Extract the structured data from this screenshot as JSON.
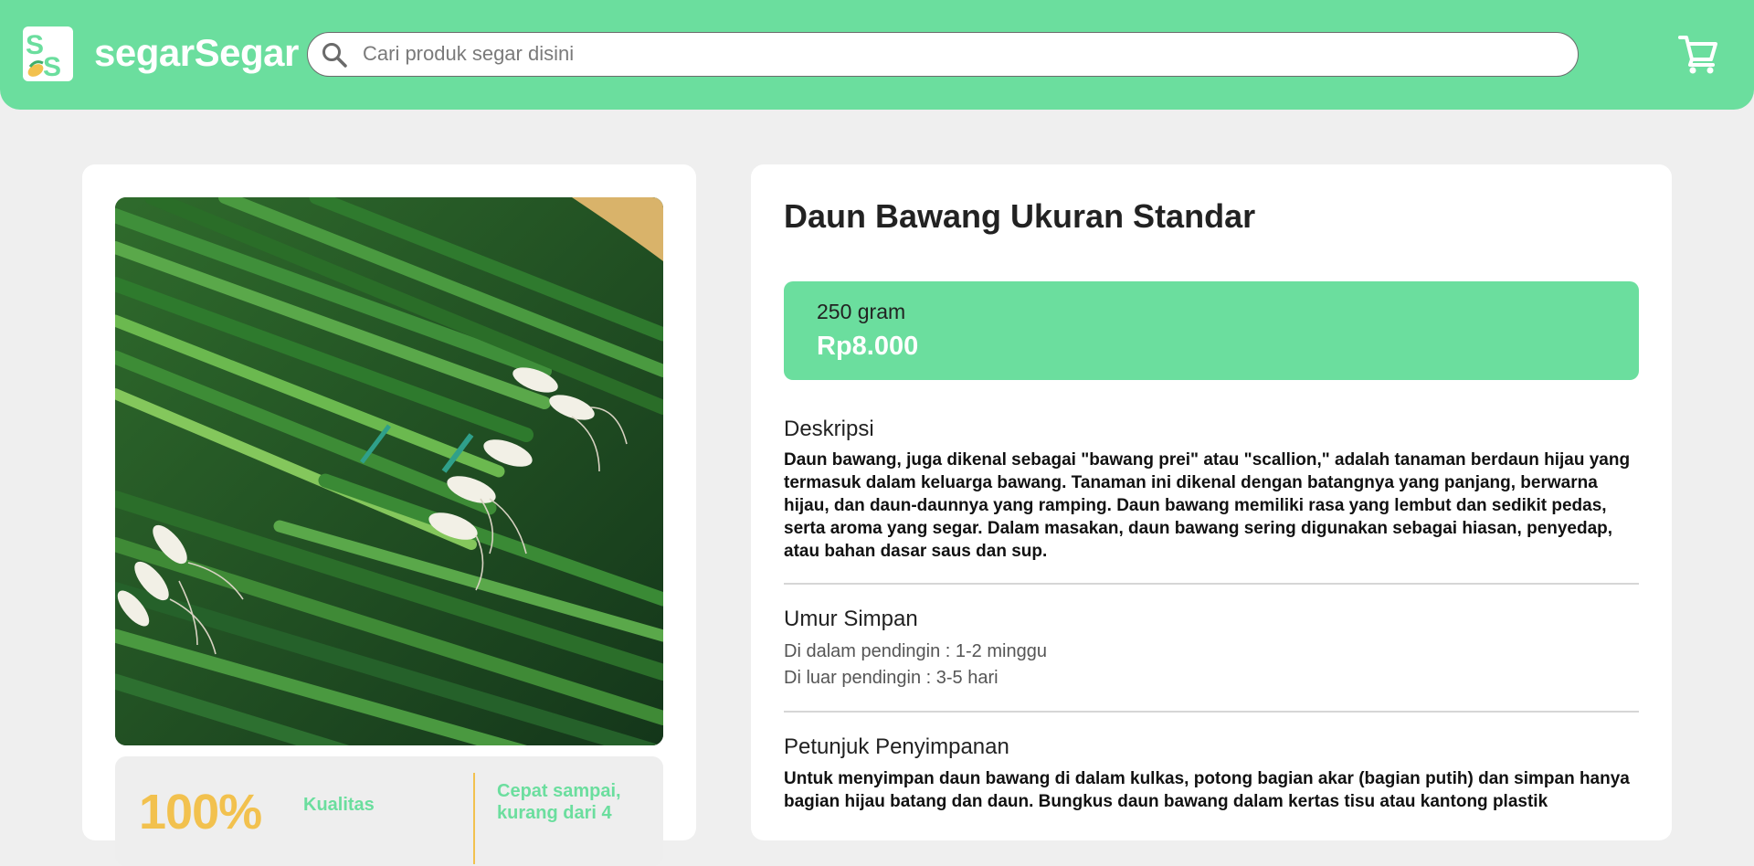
{
  "header": {
    "brand": "segarSegar",
    "search": {
      "placeholder": "Cari produk segar disini",
      "value": ""
    }
  },
  "icons": {
    "logo": "segarsegar-logo-icon",
    "search": "search-icon",
    "cart": "cart-icon"
  },
  "colors": {
    "accent_green": "#6bde9e",
    "accent_yellow": "#f2c14e",
    "background": "#efefef"
  },
  "product": {
    "title": "Daun Bawang Ukuran Standar",
    "image_alt": "Daun bawang",
    "weight": "250 gram",
    "price": "Rp8.000"
  },
  "stats": {
    "quality_value": "100%",
    "quality_label": "Kualitas",
    "delivery_text": "Cepat sampai, kurang dari 4"
  },
  "sections": {
    "description": {
      "heading": "Deskripsi",
      "body": "Daun bawang, juga dikenal sebagai \"bawang prei\" atau \"scallion,\" adalah tanaman berdaun hijau yang termasuk dalam keluarga bawang. Tanaman ini dikenal dengan batangnya yang panjang, berwarna hijau, dan daun-daunnya yang ramping. Daun bawang memiliki rasa yang lembut dan sedikit pedas, serta aroma yang segar. Dalam masakan, daun bawang sering digunakan sebagai hiasan, penyedap, atau bahan dasar saus dan sup."
    },
    "shelf_life": {
      "heading": "Umur Simpan",
      "fridge": "Di dalam pendingin : 1-2 minggu",
      "outside": "Di luar pendingin : 3-5 hari"
    },
    "storage": {
      "heading": "Petunjuk Penyimpanan",
      "body": "Untuk menyimpan daun bawang di dalam kulkas, potong bagian akar (bagian putih) dan simpan hanya bagian hijau batang dan daun. Bungkus daun bawang dalam kertas tisu atau kantong plastik"
    }
  }
}
